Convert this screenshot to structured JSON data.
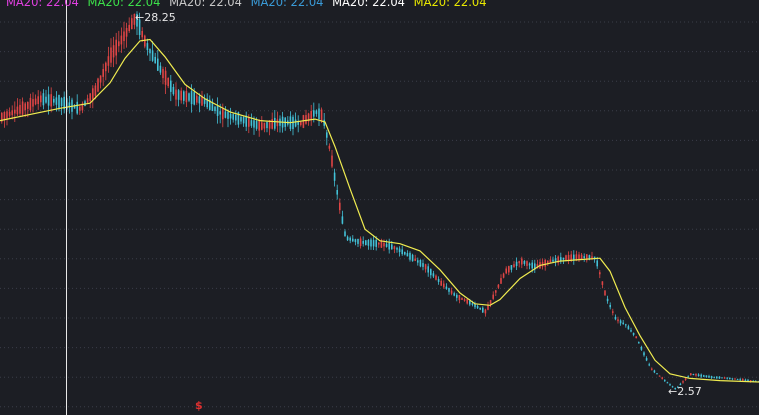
{
  "chart_data": {
    "type": "candlestick",
    "legend": [
      {
        "text": "MA20: 22.04",
        "color": "#e040e0"
      },
      {
        "text": "MA20: 22.04",
        "color": "#3ce04a"
      },
      {
        "text": "MA20: 22.04",
        "color": "#c8c8c8"
      },
      {
        "text": "MA20: 22.04",
        "color": "#3a9bd8"
      },
      {
        "text": "MA20: 22.04",
        "color": "#ffffff"
      },
      {
        "text": "MA20: 22.04",
        "color": "#e8e800"
      }
    ],
    "ylim": [
      1.5,
      29.5
    ],
    "grid": true,
    "highlight": {
      "high": 28.25,
      "high_label": "28.25",
      "low": 2.57,
      "low_label": "2.57"
    },
    "marker": {
      "text": "$",
      "color": "#e03030"
    },
    "colors": {
      "up": "#e04545",
      "down": "#43c2d8",
      "ma": "#f0ec50",
      "grid": "#3a3d48",
      "crosshair": "#e8e8e8"
    },
    "ma_series": [
      [
        0,
        21.1
      ],
      [
        60,
        21.95
      ],
      [
        90,
        22.3
      ],
      [
        110,
        23.7
      ],
      [
        125,
        25.4
      ],
      [
        140,
        26.6
      ],
      [
        150,
        26.7
      ],
      [
        165,
        25.5
      ],
      [
        185,
        23.6
      ],
      [
        205,
        22.6
      ],
      [
        230,
        21.7
      ],
      [
        260,
        21.1
      ],
      [
        290,
        20.95
      ],
      [
        315,
        21.2
      ],
      [
        325,
        21.0
      ],
      [
        335,
        19.3
      ],
      [
        350,
        16.4
      ],
      [
        365,
        13.6
      ],
      [
        380,
        12.8
      ],
      [
        400,
        12.6
      ],
      [
        420,
        12.1
      ],
      [
        440,
        10.8
      ],
      [
        460,
        9.2
      ],
      [
        475,
        8.45
      ],
      [
        490,
        8.35
      ],
      [
        500,
        8.75
      ],
      [
        520,
        10.2
      ],
      [
        540,
        11.1
      ],
      [
        560,
        11.4
      ],
      [
        580,
        11.5
      ],
      [
        600,
        11.6
      ],
      [
        610,
        10.7
      ],
      [
        625,
        8.2
      ],
      [
        640,
        6.25
      ],
      [
        655,
        4.55
      ],
      [
        670,
        3.62
      ],
      [
        690,
        3.3
      ],
      [
        720,
        3.15
      ],
      [
        759,
        3.05
      ]
    ],
    "price_path": [
      [
        0,
        21.3
      ],
      [
        20,
        21.9
      ],
      [
        40,
        22.6
      ],
      [
        60,
        22.4
      ],
      [
        80,
        21.9
      ],
      [
        95,
        23.2
      ],
      [
        110,
        25.6
      ],
      [
        125,
        27.1
      ],
      [
        135,
        28.25
      ],
      [
        145,
        26.4
      ],
      [
        160,
        24.6
      ],
      [
        175,
        22.9
      ],
      [
        190,
        22.7
      ],
      [
        205,
        22.4
      ],
      [
        220,
        21.6
      ],
      [
        240,
        21.2
      ],
      [
        260,
        20.7
      ],
      [
        280,
        21.0
      ],
      [
        300,
        20.9
      ],
      [
        315,
        21.7
      ],
      [
        322,
        21.4
      ],
      [
        330,
        18.8
      ],
      [
        337,
        15.9
      ],
      [
        345,
        13.0
      ],
      [
        360,
        12.7
      ],
      [
        380,
        12.6
      ],
      [
        395,
        12.3
      ],
      [
        410,
        11.7
      ],
      [
        425,
        11.0
      ],
      [
        440,
        9.9
      ],
      [
        455,
        9.0
      ],
      [
        470,
        8.5
      ],
      [
        485,
        7.9
      ],
      [
        495,
        9.3
      ],
      [
        505,
        10.7
      ],
      [
        520,
        11.4
      ],
      [
        535,
        11.0
      ],
      [
        550,
        11.4
      ],
      [
        565,
        11.6
      ],
      [
        580,
        11.7
      ],
      [
        595,
        11.6
      ],
      [
        605,
        9.0
      ],
      [
        615,
        7.4
      ],
      [
        625,
        7.0
      ],
      [
        635,
        6.2
      ],
      [
        650,
        4.0
      ],
      [
        665,
        3.1
      ],
      [
        675,
        2.57
      ],
      [
        690,
        3.6
      ],
      [
        710,
        3.4
      ],
      [
        730,
        3.3
      ],
      [
        759,
        3.05
      ]
    ]
  }
}
